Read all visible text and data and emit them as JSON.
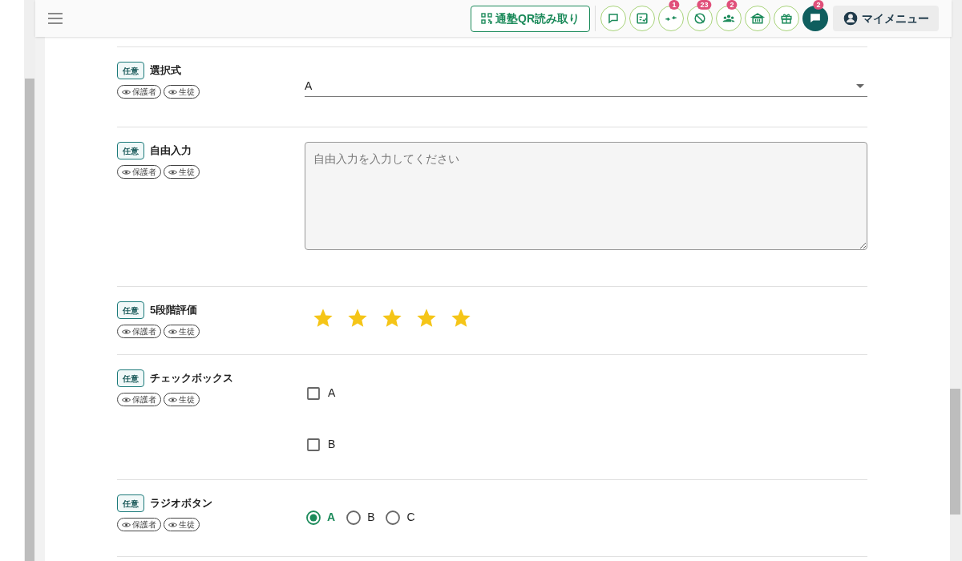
{
  "header": {
    "qr_button": "通塾QR読み取り",
    "icon_buttons": [
      {
        "kind": "chat",
        "selected": false
      },
      {
        "kind": "tasks",
        "selected": false
      },
      {
        "kind": "merge",
        "badge": "1",
        "selected": false
      },
      {
        "kind": "blocked",
        "badge": "23",
        "selected": false
      },
      {
        "kind": "group",
        "badge": "2",
        "selected": false
      },
      {
        "kind": "school",
        "selected": false
      },
      {
        "kind": "gift",
        "selected": false
      },
      {
        "kind": "chat",
        "badge": "2",
        "selected": true
      }
    ],
    "my_menu": "マイメニュー"
  },
  "fields": [
    {
      "kind": "select",
      "tag": "任意",
      "label": "選択式",
      "visibility": [
        "保護者",
        "生徒"
      ],
      "value": "A"
    },
    {
      "kind": "textarea",
      "tag": "任意",
      "label": "自由入力",
      "visibility": [
        "保護者",
        "生徒"
      ],
      "placeholder": "自由入力を入力してください"
    },
    {
      "kind": "rating",
      "tag": "任意",
      "label": "5段階評価",
      "visibility": [
        "保護者",
        "生徒"
      ],
      "stars": 5
    },
    {
      "kind": "checkbox",
      "tag": "任意",
      "label": "チェックボックス",
      "visibility": [
        "保護者",
        "生徒"
      ],
      "options": [
        {
          "label": "A",
          "checked": false
        },
        {
          "label": "B",
          "checked": false
        }
      ]
    },
    {
      "kind": "radio",
      "tag": "任意",
      "label": "ラジオボタン",
      "visibility": [
        "保護者",
        "生徒"
      ],
      "options": [
        {
          "label": "A",
          "selected": true
        },
        {
          "label": "B",
          "selected": false
        },
        {
          "label": "C",
          "selected": false
        }
      ]
    }
  ]
}
